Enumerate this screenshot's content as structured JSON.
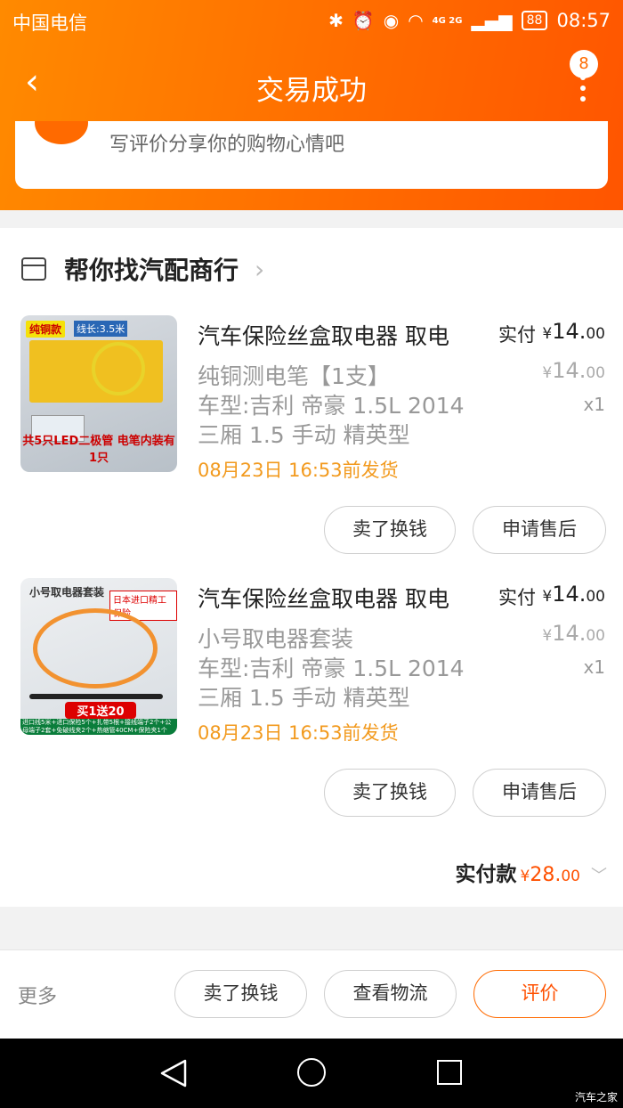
{
  "status_bar": {
    "carrier": "中国电信",
    "network": "4G 2G",
    "battery": "88",
    "time": "08:57"
  },
  "nav": {
    "title": "交易成功",
    "back_icon": "chevron-left-icon",
    "more_icon": "vertical-dots-icon",
    "badge_count": "8"
  },
  "review_prompt": {
    "text": "写评价分享你的购物心情吧"
  },
  "shop": {
    "name": "帮你找汽配商行",
    "chevron": "›"
  },
  "items": [
    {
      "title": "汽车保险丝盒取电器 取电",
      "spec": "纯铜测电笔【1支】",
      "model_line1": "车型:吉利 帝豪 1.5L 2014",
      "model_line2": "三厢 1.5 手动 精英型",
      "ship": "08月23日 16:53前发货",
      "pay_label": "实付",
      "currency": "¥",
      "pay_int": "14.",
      "pay_dec": "00",
      "orig_int": "14.",
      "orig_dec": "00",
      "qty": "x1",
      "thumb": {
        "tag": "纯铜款",
        "tag2": "线长:3.5米",
        "promo": "共5只LED二极管 电笔内装有1只"
      },
      "btn_sell": "卖了换钱",
      "btn_after": "申请售后"
    },
    {
      "title": "汽车保险丝盒取电器 取电",
      "spec": "小号取电器套装",
      "model_line1": "车型:吉利 帝豪 1.5L 2014",
      "model_line2": "三厢 1.5 手动 精英型",
      "ship": "08月23日 16:53前发货",
      "pay_label": "实付",
      "currency": "¥",
      "pay_int": "14.",
      "pay_dec": "00",
      "orig_int": "14.",
      "orig_dec": "00",
      "qty": "x1",
      "thumb": {
        "tag": "小号取电器套装",
        "tag2": "日本进口精工保险",
        "promo": "买1送20",
        "strip": "进口线5米+进口保险5个+扎带5根+接线端子2个+公母端子2套+免破线夹2个+热缩管40CM+保险夹1个"
      },
      "btn_sell": "卖了换钱",
      "btn_after": "申请售后"
    }
  ],
  "total": {
    "label": "实付款",
    "currency": "¥",
    "int": "28.",
    "dec": "00"
  },
  "bottom_bar": {
    "more": "更多",
    "sell": "卖了换钱",
    "logistics": "查看物流",
    "rate": "评价"
  },
  "watermark": "汽车之家",
  "colors": {
    "brand_orange": "#ff6a00",
    "ship_text": "#f29a1e",
    "price_orange": "#ff5000"
  }
}
